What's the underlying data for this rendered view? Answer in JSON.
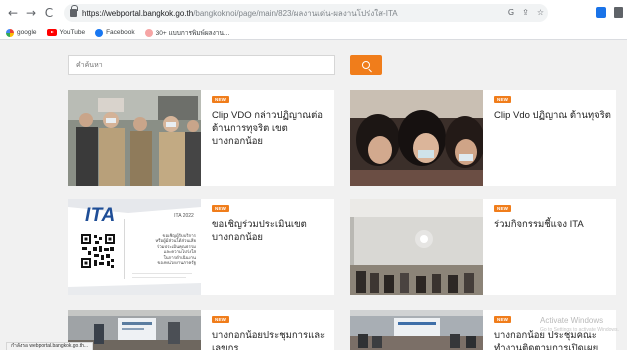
{
  "browser": {
    "url_host": "https://webportal.bangkok.go.th",
    "url_path": "/bangkoknoi/page/main/823/ผลงานเด่น-ผลงานโปร่งใส-ITA",
    "back": "←",
    "forward": "→",
    "reload": "C",
    "actions": [
      "G",
      "⇪",
      "☆"
    ]
  },
  "bookmarks": [
    {
      "label": "google",
      "icon": "google-icon"
    },
    {
      "label": "YouTube",
      "icon": "youtube-icon"
    },
    {
      "label": "Facebook",
      "icon": "facebook-icon"
    },
    {
      "label": "30+ แบบการพิมพ์ผลงาน...",
      "icon": "site-icon"
    }
  ],
  "search": {
    "placeholder": "คำค้นหา"
  },
  "cards": [
    {
      "badge": "NEW",
      "title": "Clip VDO กล่าวปฏิญาณต่อต้านการทุจริต เขตบางกอกน้อย"
    },
    {
      "badge": "NEW",
      "title": "Clip Vdo ปฏิญาณ ต้านทุจริต"
    },
    {
      "badge": "NEW",
      "title": "ขอเชิญร่วมประเมินเขตบางกอกน้อย"
    },
    {
      "badge": "NEW",
      "title": "ร่วมกิจกรรมชี้แจง ITA"
    },
    {
      "badge": "NEW",
      "title": "บางกอกน้อยประชุมการและเลขกร"
    },
    {
      "badge": "NEW",
      "title": "บางกอกน้อย ประชุมคณะทำงานติดตามการเปิดเผย"
    }
  ],
  "ita_card": {
    "logo": "ITA",
    "year": "ITA 2022",
    "lines": [
      "ขอเชิญผู้รับบริการ",
      "หรือผู้มีส่วนได้ส่วนเสีย",
      "ร่วมประเมินคุณธรรม",
      "และความโปร่งใส",
      "ในการดำเนินงาน",
      "ของหน่วยงานภาครัฐ"
    ]
  },
  "status_bar": "กำลังรอ webportal.bangkok.go.th...",
  "watermark": {
    "title": "Activate Windows",
    "subtitle": "Go to Settings to activate Windows."
  },
  "colors": {
    "accent": "#f07d1b",
    "page_bg": "#f1f1f1"
  }
}
